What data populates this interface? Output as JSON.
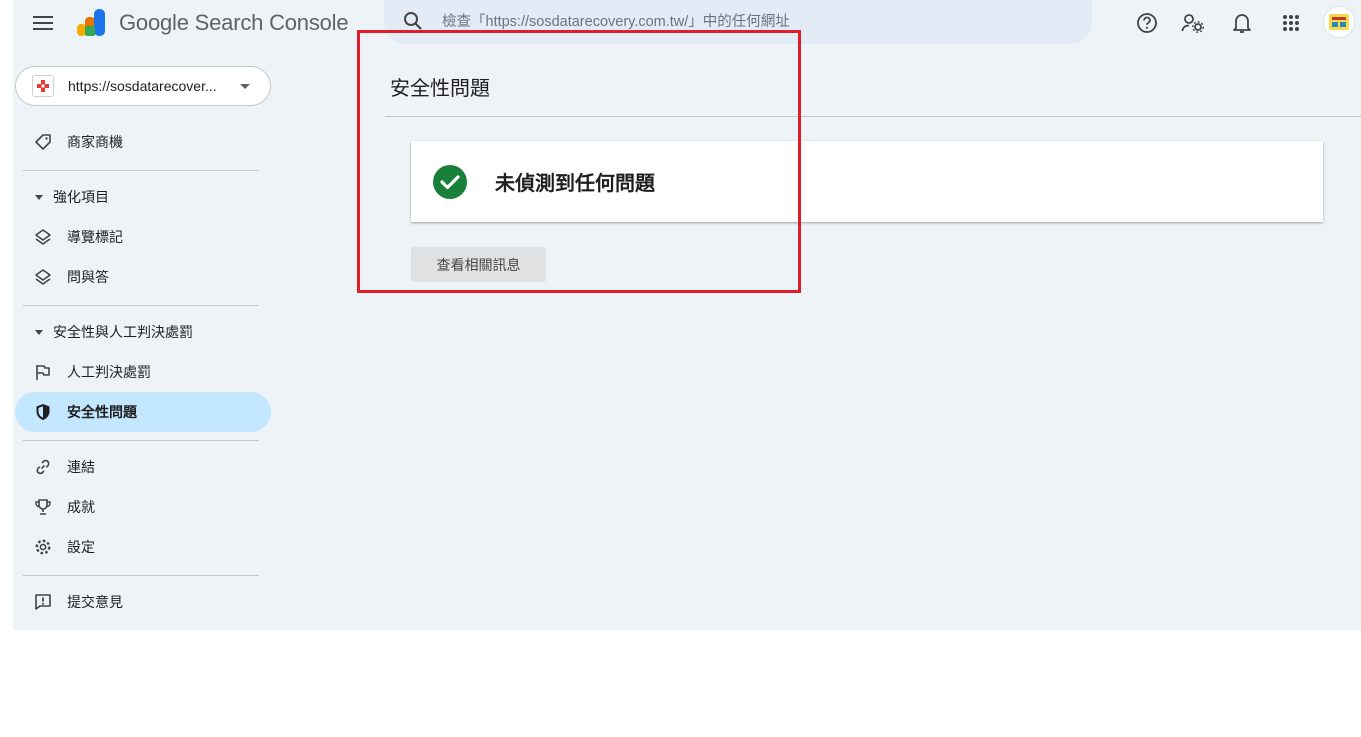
{
  "app": {
    "brand": "Google Search Console"
  },
  "search": {
    "placeholder": "檢查「https://sosdatarecovery.com.tw/」中的任何網址"
  },
  "top_icons": [
    "help-icon",
    "admin-settings-icon",
    "notifications-icon",
    "apps-grid-icon"
  ],
  "sidebar": {
    "property_label": "https://sosdatarecover...",
    "items": {
      "merchant": "商家商機",
      "enhancements_header": "強化項目",
      "breadcrumbs": "導覽標記",
      "qa": "問與答",
      "security_header": "安全性與人工判決處罰",
      "manual_actions": "人工判決處罰",
      "security_issues": "安全性問題",
      "links": "連結",
      "achievements": "成就",
      "settings": "設定",
      "feedback": "提交意見"
    }
  },
  "main": {
    "title": "安全性問題",
    "status_message": "未偵測到任何問題",
    "learn_more": "查看相關訊息"
  },
  "colors": {
    "background": "#eef3f8",
    "active_nav": "#c2e7ff",
    "success": "#188038",
    "highlight": "#e11d28"
  }
}
